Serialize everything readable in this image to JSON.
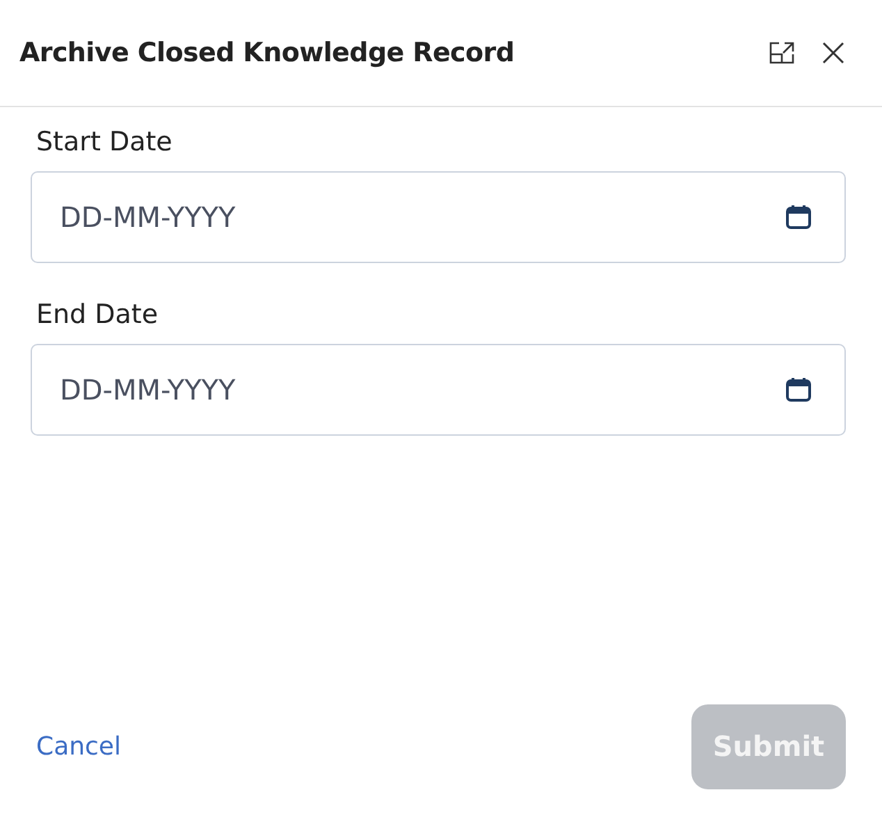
{
  "dialog": {
    "title": "Archive Closed Knowledge Record"
  },
  "fields": [
    {
      "label": "Start Date",
      "placeholder": "DD-MM-YYYY"
    },
    {
      "label": "End Date",
      "placeholder": "DD-MM-YYYY"
    }
  ],
  "footer": {
    "cancel": "Cancel",
    "submit": {
      "label": "Submit",
      "disabled": true
    }
  }
}
